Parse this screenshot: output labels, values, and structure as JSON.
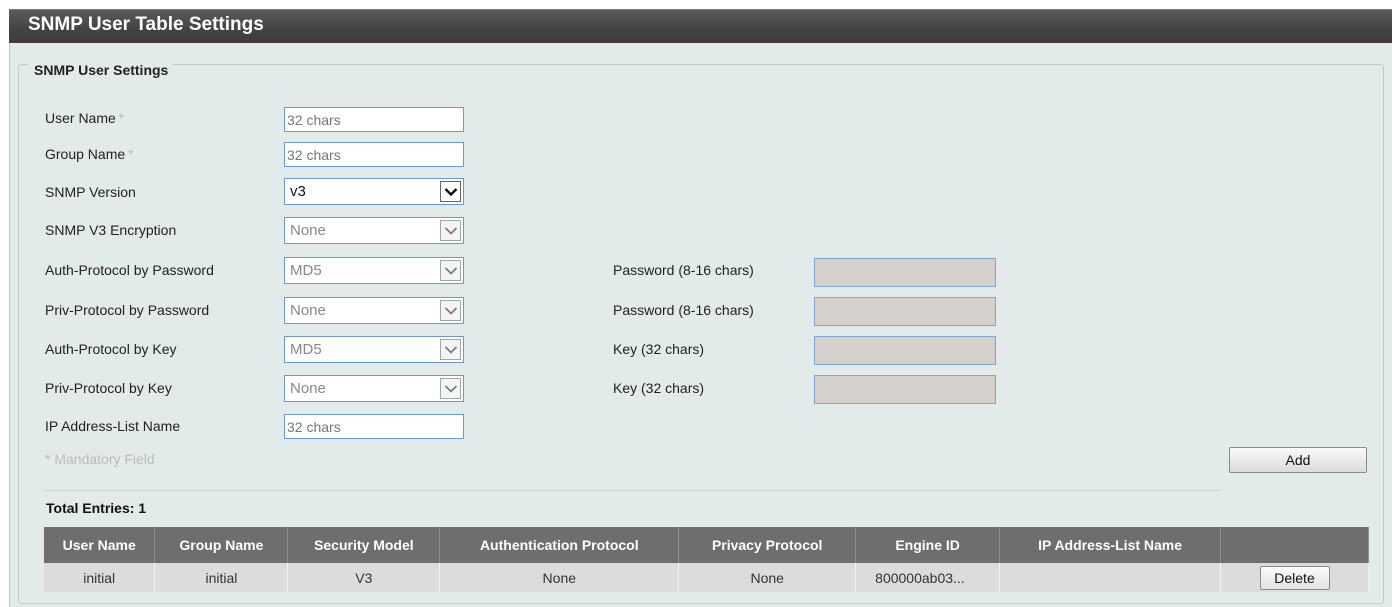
{
  "page": {
    "title": "SNMP User Table Settings"
  },
  "section": {
    "legend": "SNMP User Settings"
  },
  "form": {
    "user_name": {
      "label": "User Name",
      "placeholder": "32 chars"
    },
    "group_name": {
      "label": "Group Name",
      "placeholder": "32 chars"
    },
    "snmp_version": {
      "label": "SNMP Version",
      "value": "v3"
    },
    "v3_encryption": {
      "label": "SNMP V3 Encryption",
      "value": "None"
    },
    "auth_protocol_password": {
      "label": "Auth-Protocol by Password",
      "value": "MD5",
      "side_label": "Password (8-16 chars)"
    },
    "priv_protocol_password": {
      "label": "Priv-Protocol by Password",
      "value": "None",
      "side_label": "Password (8-16 chars)"
    },
    "auth_protocol_key": {
      "label": "Auth-Protocol by Key",
      "value": "MD5",
      "side_label": "Key (32 chars)"
    },
    "priv_protocol_key": {
      "label": "Priv-Protocol by Key",
      "value": "None",
      "side_label": "Key (32 chars)"
    },
    "ip_address_list": {
      "label": "IP Address-List Name",
      "placeholder": "32 chars"
    },
    "mandatory_star": "*",
    "mandatory_note": "* Mandatory Field",
    "add_label": "Add"
  },
  "table": {
    "total_entries": "Total Entries: 1",
    "headers": [
      "User Name",
      "Group Name",
      "Security Model",
      "Authentication Protocol",
      "Privacy Protocol",
      "Engine ID",
      "IP Address-List Name",
      ""
    ],
    "rows": [
      [
        "initial",
        "initial",
        "V3",
        "None",
        "None",
        "800000ab03...",
        "",
        "Delete"
      ]
    ]
  },
  "colors": {
    "title_bar": "#444444",
    "panel_bg": "#e3ebea",
    "input_border": "#6b9ad1",
    "disabled_input": "#d5d0cb",
    "table_header": "#6e6e6e"
  }
}
